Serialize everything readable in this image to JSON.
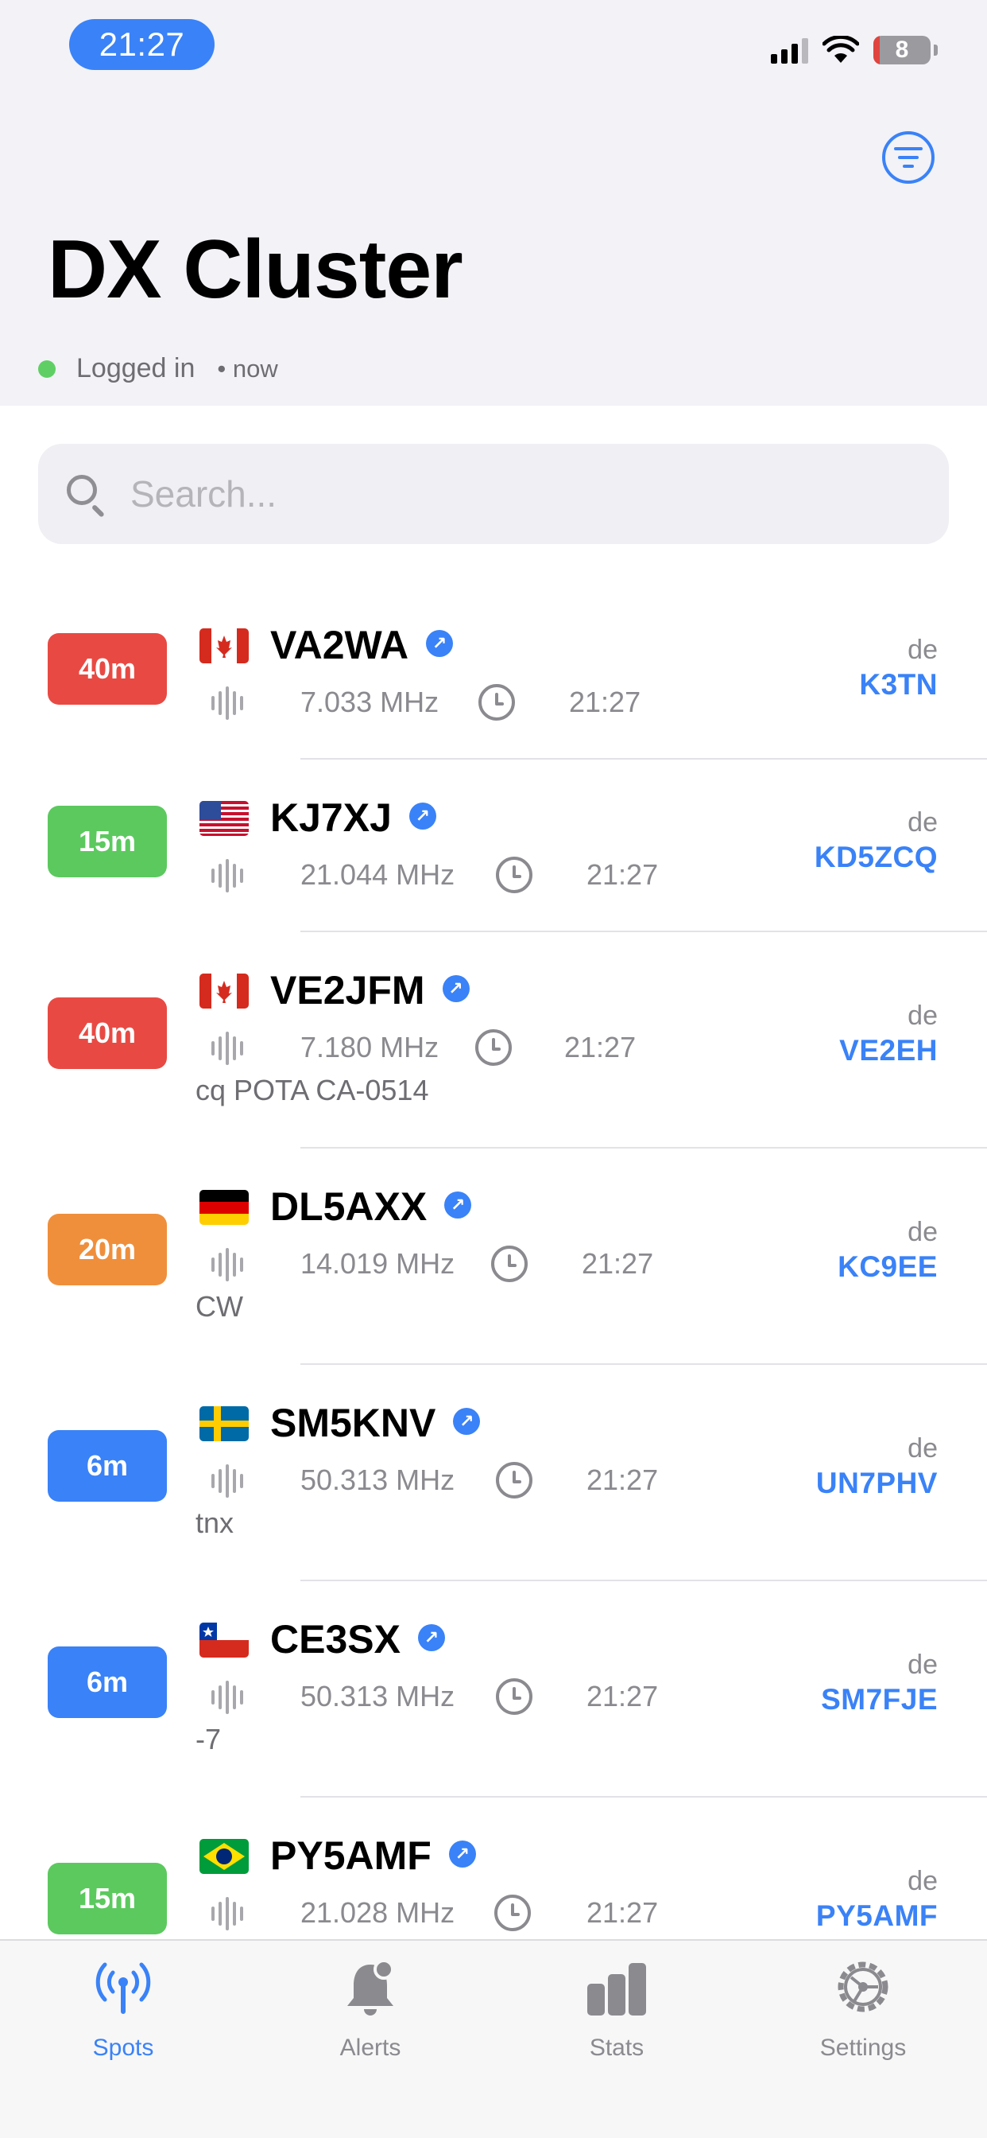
{
  "status_bar": {
    "time": "21:27",
    "battery": "8"
  },
  "header": {
    "title": "DX Cluster",
    "login_status": "Logged in",
    "login_time": "• now"
  },
  "search": {
    "placeholder": "Search..."
  },
  "spots": [
    {
      "band": "40m",
      "band_color": "#e84a43",
      "flag": "Canada",
      "callsign": "VA2WA",
      "frequency": "7.033 MHz",
      "time": "21:27",
      "comment": "",
      "de_label": "de",
      "spotter": "K3TN"
    },
    {
      "band": "15m",
      "band_color": "#5cc95f",
      "flag": "United States",
      "callsign": "KJ7XJ",
      "frequency": "21.044 MHz",
      "time": "21:27",
      "comment": "",
      "de_label": "de",
      "spotter": "KD5ZCQ"
    },
    {
      "band": "40m",
      "band_color": "#e84a43",
      "flag": "Canada",
      "callsign": "VE2JFM",
      "frequency": "7.180 MHz",
      "time": "21:27",
      "comment": "cq POTA CA-0514",
      "de_label": "de",
      "spotter": "VE2EH"
    },
    {
      "band": "20m",
      "band_color": "#ef8f3c",
      "flag": "Germany",
      "callsign": "DL5AXX",
      "frequency": "14.019 MHz",
      "time": "21:27",
      "comment": "CW",
      "de_label": "de",
      "spotter": "KC9EE"
    },
    {
      "band": "6m",
      "band_color": "#3a82f7",
      "flag": "Sweden",
      "callsign": "SM5KNV",
      "frequency": "50.313 MHz",
      "time": "21:27",
      "comment": "tnx",
      "de_label": "de",
      "spotter": "UN7PHV"
    },
    {
      "band": "6m",
      "band_color": "#3a82f7",
      "flag": "Chile",
      "callsign": "CE3SX",
      "frequency": "50.313 MHz",
      "time": "21:27",
      "comment": "-7",
      "de_label": "de",
      "spotter": "SM7FJE"
    },
    {
      "band": "15m",
      "band_color": "#5cc95f",
      "flag": "Brazil",
      "callsign": "PY5AMF",
      "frequency": "21.028 MHz",
      "time": "21:27",
      "comment": "",
      "de_label": "de",
      "spotter": "PY5AMF"
    }
  ],
  "tabs": [
    {
      "label": "Spots",
      "icon": "antenna-icon",
      "active": true
    },
    {
      "label": "Alerts",
      "icon": "bell-icon",
      "active": false
    },
    {
      "label": "Stats",
      "icon": "bar-chart-icon",
      "active": false
    },
    {
      "label": "Settings",
      "icon": "gear-icon",
      "active": false
    }
  ],
  "colors": {
    "accent": "#3a82f7",
    "online": "#5fcf65"
  }
}
